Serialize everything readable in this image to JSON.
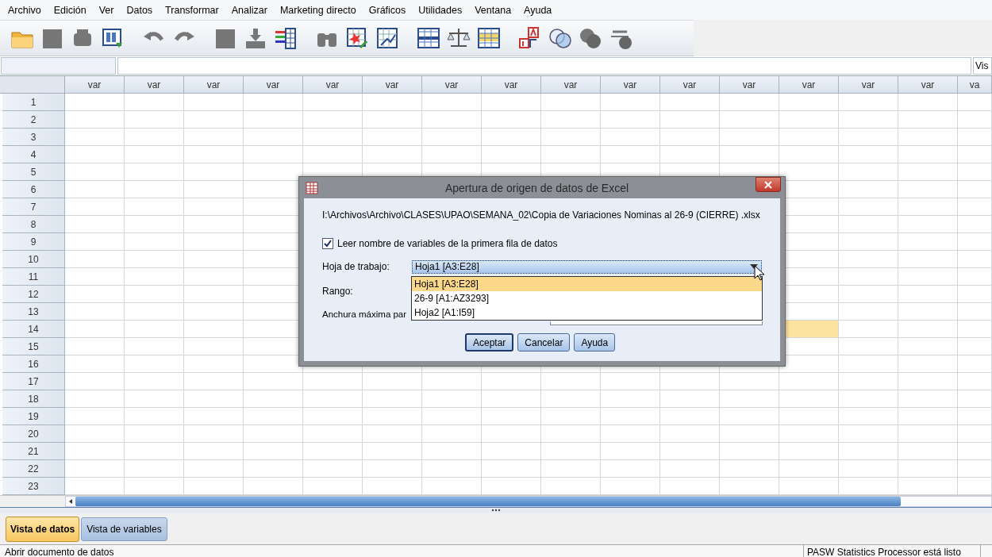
{
  "menu": [
    {
      "label": "Archivo"
    },
    {
      "label": "Edición"
    },
    {
      "label": "Ver"
    },
    {
      "label": "Datos"
    },
    {
      "label": "Transformar"
    },
    {
      "label": "Analizar"
    },
    {
      "label": "Marketing directo"
    },
    {
      "label": "Gráficos"
    },
    {
      "label": "Utilidades"
    },
    {
      "label": "Ventana"
    },
    {
      "label": "Ayuda"
    }
  ],
  "cell_editor": {
    "visible_label": "Vis"
  },
  "grid": {
    "columns": [
      {
        "label": "var",
        "selected": false
      },
      {
        "label": "var",
        "selected": false
      },
      {
        "label": "var",
        "selected": false
      },
      {
        "label": "var",
        "selected": false
      },
      {
        "label": "var",
        "selected": false
      },
      {
        "label": "var",
        "selected": false
      },
      {
        "label": "var",
        "selected": false
      },
      {
        "label": "var",
        "selected": false
      },
      {
        "label": "var",
        "selected": false
      },
      {
        "label": "var",
        "selected": false
      },
      {
        "label": "var",
        "selected": false
      },
      {
        "label": "var",
        "selected": false
      },
      {
        "label": "var",
        "selected": true
      },
      {
        "label": "var",
        "selected": false
      },
      {
        "label": "var",
        "selected": false
      },
      {
        "label": "va",
        "selected": false
      }
    ],
    "rows": [
      {
        "label": "1",
        "selected": false
      },
      {
        "label": "2",
        "selected": false
      },
      {
        "label": "3",
        "selected": false
      },
      {
        "label": "4",
        "selected": false
      },
      {
        "label": "5",
        "selected": false
      },
      {
        "label": "6",
        "selected": false
      },
      {
        "label": "7",
        "selected": false
      },
      {
        "label": "8",
        "selected": false
      },
      {
        "label": "9",
        "selected": false
      },
      {
        "label": "10",
        "selected": false
      },
      {
        "label": "11",
        "selected": false
      },
      {
        "label": "12",
        "selected": false
      },
      {
        "label": "13",
        "selected": false
      },
      {
        "label": "14",
        "selected": true
      },
      {
        "label": "15",
        "selected": false
      },
      {
        "label": "16",
        "selected": false
      },
      {
        "label": "17",
        "selected": false
      },
      {
        "label": "18",
        "selected": false
      },
      {
        "label": "19",
        "selected": false
      },
      {
        "label": "20",
        "selected": false
      },
      {
        "label": "21",
        "selected": false
      },
      {
        "label": "22",
        "selected": false
      },
      {
        "label": "23",
        "selected": false
      }
    ]
  },
  "dialog": {
    "title": "Apertura de origen de datos de Excel",
    "path": "I:\\Archivos\\Archivo\\CLASES\\UPAO\\SEMANA_02\\Copia de Variaciones Nominas al 26-9 (CIERRE) .xlsx",
    "checkbox": {
      "label": "Leer nombre de variables de la primera fila de datos",
      "checked": true
    },
    "worksheet": {
      "label": "Hoja de trabajo:",
      "value": "Hoja1 [A3:E28]",
      "expanded": true,
      "options": [
        {
          "label": "Hoja1 [A3:E28]",
          "selected": true
        },
        {
          "label": "26-9 [A1:AZ3293]",
          "selected": false
        },
        {
          "label": "Hoja2 [A1:I59]",
          "selected": false
        }
      ]
    },
    "range_label": "Rango:",
    "max_width_label": "Anchura máxima par",
    "buttons": [
      {
        "label": "Aceptar",
        "focused": true
      },
      {
        "label": "Cancelar",
        "focused": false
      },
      {
        "label": "Ayuda",
        "focused": false
      }
    ]
  },
  "view_tabs": [
    {
      "label": "Vista de datos",
      "selected": true
    },
    {
      "label": "Vista de variables",
      "selected": false
    }
  ],
  "status_bar": {
    "left": "Abrir documento de datos",
    "right": "PASW Statistics Processor está listo"
  }
}
